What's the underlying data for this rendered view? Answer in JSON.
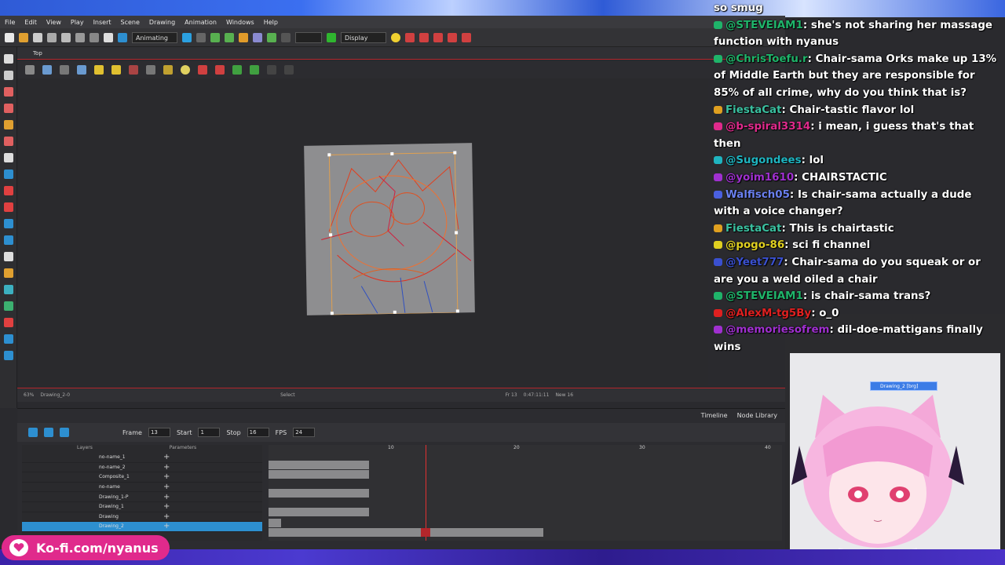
{
  "menu": [
    "File",
    "Edit",
    "View",
    "Play",
    "Insert",
    "Scene",
    "Drawing",
    "Animation",
    "Windows",
    "Help"
  ],
  "toolbar": {
    "mode": "Animating",
    "display": "Display"
  },
  "view": {
    "tab": "Top",
    "status_zoom": "63%",
    "status_layer": "Drawing_2-0",
    "status_tool": "Select",
    "status_frame": "Fr 13",
    "status_time": "0:47:11:11",
    "status_view": "New 16"
  },
  "timeline": {
    "tabs": [
      "Timeline",
      "Node Library"
    ],
    "frame_label": "Frame",
    "frame": "13",
    "start_label": "Start",
    "start": "1",
    "stop_label": "Stop",
    "stop": "16",
    "fps_label": "FPS",
    "fps": "24",
    "layers_header": "Layers",
    "params_header": "Parameters",
    "ruler": [
      "10",
      "20",
      "30",
      "40"
    ],
    "layers": [
      "no-name_1",
      "no-name_2",
      "Composite_1",
      "no-name",
      "Drawing_1-P",
      "Drawing_1",
      "Drawing",
      "Drawing_2"
    ]
  },
  "node": {
    "label": "Drawing_2 [brg]"
  },
  "chat": [
    {
      "user": "",
      "text": "so smug"
    },
    {
      "user": "@STEVEIAM1",
      "text": ": she's not sharing her massage function with nyanus"
    },
    {
      "user": "@ChrisToefu.r",
      "text": ": Chair-sama Orks make up 13% of Middle Earth but they are responsible for 85% of all crime, why do you think that is?"
    },
    {
      "user": "FiestaCat",
      "text": ": Chair-tastic flavor lol"
    },
    {
      "user": "@b-spiral3314",
      "text": ": i mean, i guess that's that then"
    },
    {
      "user": "@Sugondees",
      "text": ": lol"
    },
    {
      "user": "@yoim1610",
      "text": ": CHAIRSTACTIC"
    },
    {
      "user": "Walfisch05",
      "text": ": Is chair-sama actually a dude with a voice changer?"
    },
    {
      "user": "FiestaCat",
      "text": ": This is chairtastic"
    },
    {
      "user": "@pogo-86",
      "text": ": sci fi channel"
    },
    {
      "user": "@Yeet777",
      "text": ": Chair-sama do you squeak or or are you a weld oiled a chair"
    },
    {
      "user": "@STEVEIAM1",
      "text": ": is chair-sama trans?"
    },
    {
      "user": "@AlexM-tg5By",
      "text": ": o_0"
    },
    {
      "user": "@memoriesofrem",
      "text": ": dil-doe-mattigans finally wins"
    }
  ],
  "kofi": "Ko-fi.com/nyanus",
  "colors": {
    "accent_red": "#b3262b",
    "kofi_pink": "#e02a8c",
    "chat_green": "#1fb46a"
  }
}
